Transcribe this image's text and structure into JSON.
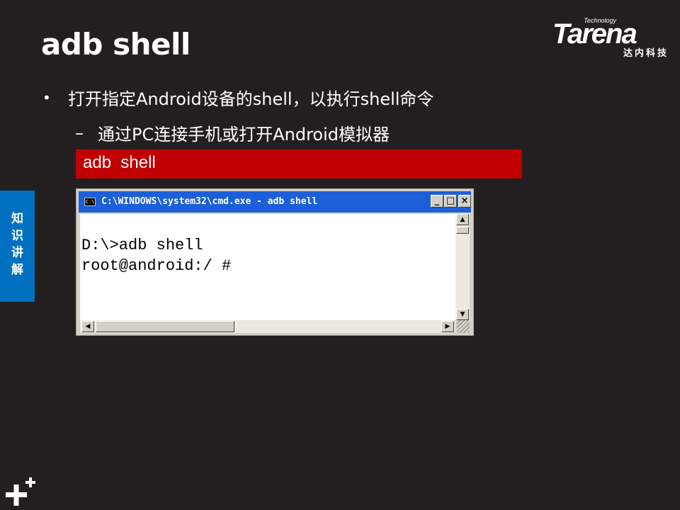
{
  "slide": {
    "title": "adb shell",
    "bullet": "打开指定Android设备的shell，以执行shell命令",
    "sub_bullet": "通过PC连接手机或打开Android模拟器",
    "code": "adb  shell"
  },
  "logo": {
    "tech": "Technology",
    "word": "Tarena",
    "cn": "达内科技"
  },
  "side_tab": [
    "知",
    "识",
    "讲",
    "解"
  ],
  "cmd_window": {
    "icon_text": "C:\\",
    "title": "C:\\WINDOWS\\system32\\cmd.exe - adb shell",
    "buttons": {
      "minimize": "_",
      "maximize": "□",
      "close": "×"
    },
    "lines": [
      "D:\\>adb shell",
      "root@android:/ #"
    ]
  },
  "colors": {
    "background": "#231f20",
    "code_bar": "#c00000",
    "side_tab": "#0070c0",
    "titlebar": "#1c5fd8"
  }
}
